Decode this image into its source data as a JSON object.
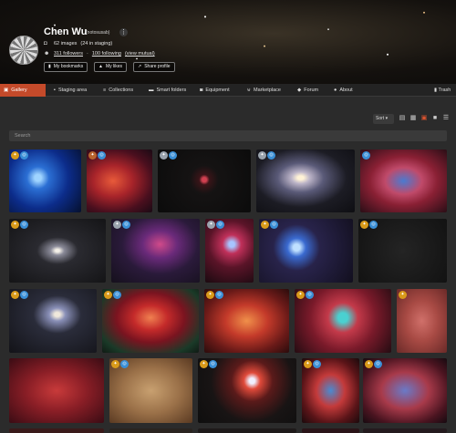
{
  "profile": {
    "name": "Chen Wu",
    "handle": "(notosusab)",
    "images_stat": "62 images",
    "staging_stat": "(24 in staging)",
    "followers": "311 followers",
    "separator": "·",
    "following": "100 following",
    "mutual": "(view mutual)",
    "buttons": [
      {
        "label": "My bookmarks",
        "icon": "bookmark-icon"
      },
      {
        "label": "My likes",
        "icon": "thumbs-up-icon"
      },
      {
        "label": "Share profile",
        "icon": "share-icon"
      }
    ]
  },
  "nav": {
    "tabs": [
      {
        "label": "Gallery",
        "icon": "image-icon",
        "active": true
      },
      {
        "label": "Staging area",
        "icon": "lock-icon"
      },
      {
        "label": "Collections",
        "icon": "layers-icon"
      },
      {
        "label": "Smart folders",
        "icon": "folder-icon"
      },
      {
        "label": "Equipment",
        "icon": "camera-icon"
      },
      {
        "label": "Marketplace",
        "icon": "cart-icon"
      },
      {
        "label": "Forum",
        "icon": "comments-icon"
      },
      {
        "label": "About",
        "icon": "user-icon"
      }
    ],
    "trash": "Trash"
  },
  "toolbar": {
    "sort_label": "Sort",
    "view_icons": [
      "list-view-icon",
      "small-grid-icon",
      "large-grid-icon",
      "tile-view-icon",
      "detail-list-icon"
    ],
    "active_view": "large-grid-icon"
  },
  "search": {
    "placeholder": "Search"
  },
  "accent": "#c44a2a",
  "gallery": {
    "tiles": [
      {
        "name": "blue-nebula",
        "badges": [
          "gold",
          "blue"
        ]
      },
      {
        "name": "red-nebula-1",
        "badges": [
          "bronze",
          "blue"
        ]
      },
      {
        "name": "starfield-red-dot",
        "badges": [
          "silver",
          "blue"
        ]
      },
      {
        "name": "pinwheel-galaxy",
        "badges": [
          "silver",
          "blue"
        ]
      },
      {
        "name": "tadpole-nebula",
        "badges": [
          "blue"
        ]
      },
      {
        "name": "spiral-galaxy",
        "badges": [
          "gold",
          "blue"
        ]
      },
      {
        "name": "arc-nebula",
        "badges": [
          "silver",
          "blue"
        ]
      },
      {
        "name": "red-circular-nebula",
        "badges": [
          "silver",
          "blue"
        ]
      },
      {
        "name": "blue-planetary-nebula",
        "badges": [
          "gold",
          "blue"
        ]
      },
      {
        "name": "dark-starfield",
        "badges": [
          "gold",
          "blue"
        ]
      },
      {
        "name": "whirlpool-galaxy",
        "badges": [
          "gold",
          "blue"
        ]
      },
      {
        "name": "horsehead-nebula",
        "badges": [
          "gold",
          "blue"
        ]
      },
      {
        "name": "elephant-trunk",
        "badges": [
          "gold",
          "blue"
        ]
      },
      {
        "name": "cygnus-bubble",
        "badges": [
          "gold",
          "blue"
        ]
      },
      {
        "name": "dark-nebula-red",
        "badges": [
          "gold"
        ]
      },
      {
        "name": "red-hydrogen-cloud",
        "badges": []
      },
      {
        "name": "dark-dust-cloud",
        "badges": [
          "gold",
          "blue"
        ]
      },
      {
        "name": "red-emission-nebula",
        "badges": [
          "gold",
          "blue"
        ]
      },
      {
        "name": "tulip-nebula",
        "badges": [
          "gold",
          "blue"
        ]
      },
      {
        "name": "veil-nebula",
        "badges": [
          "gold",
          "blue"
        ]
      }
    ]
  }
}
